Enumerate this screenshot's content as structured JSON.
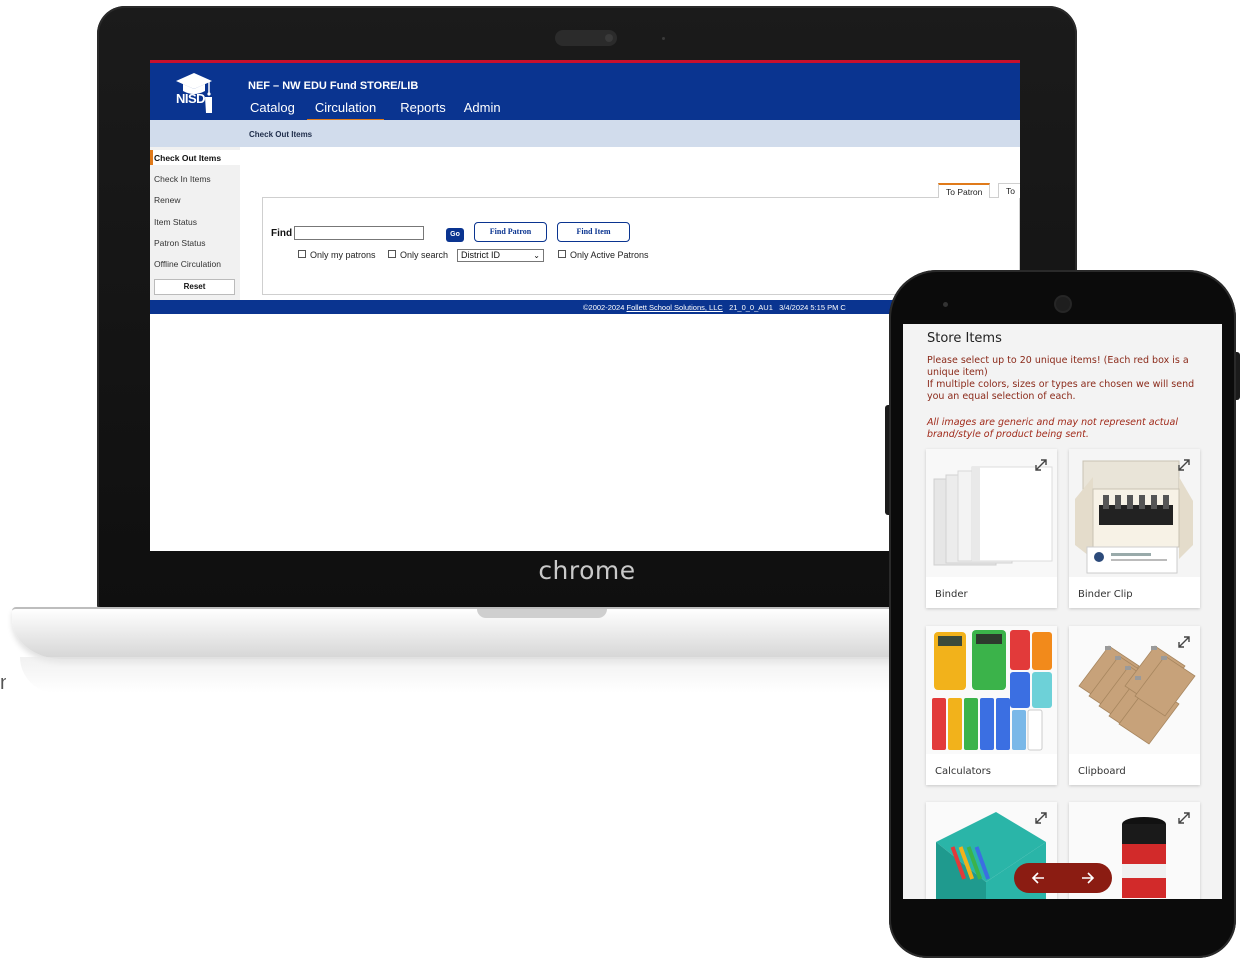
{
  "laptop": {
    "brand": "chrome"
  },
  "app": {
    "logo_text": "NISD",
    "site_name": "NEF – NW EDU Fund STORE/LIB",
    "nav": [
      {
        "label": "Catalog"
      },
      {
        "label": "Circulation",
        "active": true
      },
      {
        "label": "Reports"
      },
      {
        "label": "Admin"
      }
    ],
    "page_title": "Check Out Items",
    "sidebar": [
      {
        "label": "Check Out Items",
        "active": true
      },
      {
        "label": "Check In Items"
      },
      {
        "label": "Renew"
      },
      {
        "label": "Item Status"
      },
      {
        "label": "Patron Status"
      },
      {
        "label": "Offline Circulation"
      }
    ],
    "reset_label": "Reset",
    "tabs": [
      {
        "label": "To Patron",
        "active": true
      },
      {
        "label": "To"
      }
    ],
    "find": {
      "label": "Find",
      "value": "",
      "go_label": "Go",
      "find_patron_label": "Find Patron",
      "find_item_label": "Find Item",
      "only_my_patrons_label": "Only my patrons",
      "only_search_label": "Only search",
      "search_field_selected": "District ID",
      "only_active_patrons_label": "Only Active Patrons"
    },
    "footer": {
      "copyright": "©2002-2024",
      "company_link": "Follett School Solutions, LLC",
      "version": "21_0_0_AU1",
      "timestamp": "3/4/2024 5:15 PM C"
    },
    "colors": {
      "header_blue": "#0a3490",
      "accent_orange": "#e07a1a",
      "top_red": "#c8102e"
    }
  },
  "store": {
    "title": "Store Items",
    "description": "Please select up to 20 unique items! (Each red box is a unique item)\nIf multiple colors, sizes or types are chosen we will send you an equal selection of each.",
    "note": "All images are generic and may not represent actual brand/style of product being sent.",
    "items": [
      {
        "label": "Binder"
      },
      {
        "label": "Binder Clip"
      },
      {
        "label": "Calculators"
      },
      {
        "label": "Clipboard"
      },
      {
        "label": ""
      },
      {
        "label": ""
      }
    ],
    "colors": {
      "text_red": "#8b2a1a",
      "pill": "#8b1c12"
    }
  }
}
